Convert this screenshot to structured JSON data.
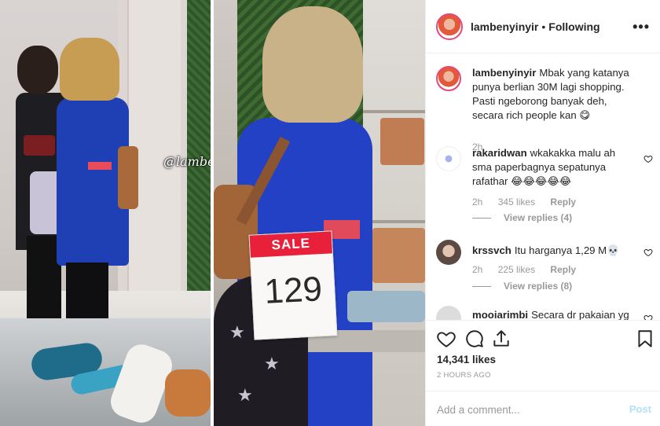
{
  "post": {
    "watermark": "@lambenyinyir",
    "sale_tag": {
      "label": "SALE",
      "price": "129"
    }
  },
  "header": {
    "username": "lambenyinyir",
    "separator": "•",
    "follow_status": "Following",
    "more_icon": "more-horizontal-icon"
  },
  "comments": [
    {
      "username": "lambenyinyir",
      "text": "Mbak yang katanya punya berlian 30M lagi shopping. Pasti ngeborong banyak deh, secara rich people kan 😋",
      "time": "2h"
    },
    {
      "username": "rakaridwan",
      "text": "wkakakka malu ah sma paperbagnya sepatunya rafathar 😂😂😂😂😂",
      "time": "2h",
      "likes": "345 likes",
      "reply": "Reply",
      "view_replies": "View replies (4)"
    },
    {
      "username": "krssvch",
      "text": "Itu harganya 1,29 M💀",
      "time": "2h",
      "likes": "225 likes",
      "reply": "Reply",
      "view_replies": "View replies (8)"
    },
    {
      "username": "mooiarimbi",
      "text": "Secara dr pakaian yg"
    }
  ],
  "actions": {
    "likes": "14,341 likes",
    "posted_ago": "2 HOURS AGO",
    "comment_placeholder": "Add a comment...",
    "post_label": "Post"
  },
  "colors": {
    "link_blue_disabled": "#b2dffc",
    "meta_gray": "#999999",
    "text": "#262626"
  }
}
